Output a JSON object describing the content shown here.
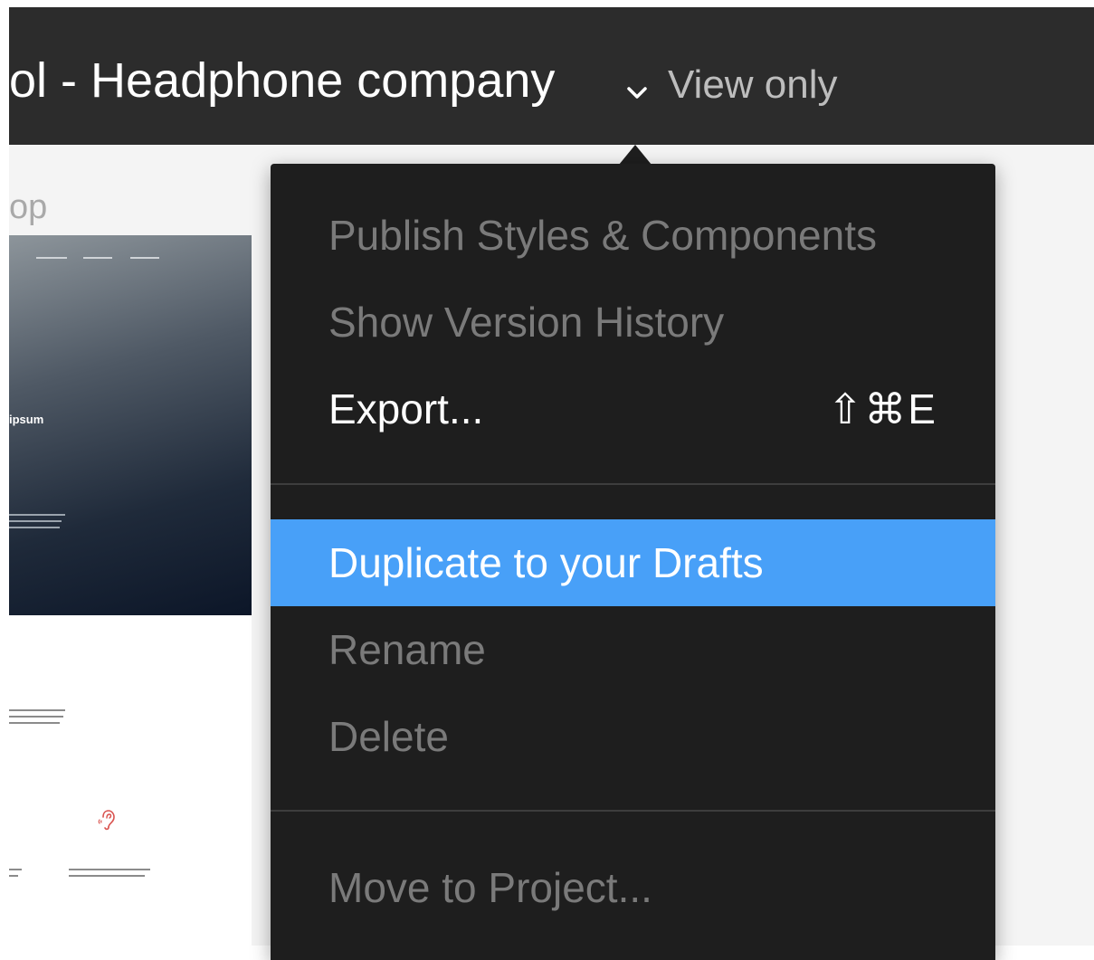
{
  "header": {
    "file_title": "ol - Headphone company",
    "chevron_icon": "chevron-down-icon",
    "access_label": "View only"
  },
  "canvas": {
    "frame_label": "op",
    "hero_heading": "ipsum",
    "illustration_icon": "ear-icon"
  },
  "menu": {
    "items": [
      {
        "label": "Publish Styles & Components",
        "state": "disabled"
      },
      {
        "label": "Show Version History",
        "state": "disabled"
      },
      {
        "label": "Export...",
        "state": "enabled",
        "shortcut": "⇧⌘E"
      },
      {
        "label": "Duplicate to your Drafts",
        "state": "highlighted"
      },
      {
        "label": "Rename",
        "state": "disabled"
      },
      {
        "label": "Delete",
        "state": "disabled"
      },
      {
        "label": "Move to Project...",
        "state": "disabled"
      }
    ]
  },
  "colors": {
    "header_bg": "#2c2c2c",
    "menu_bg": "#1e1e1e",
    "highlight": "#48a0f8",
    "disabled_text": "#7a7a7a"
  }
}
